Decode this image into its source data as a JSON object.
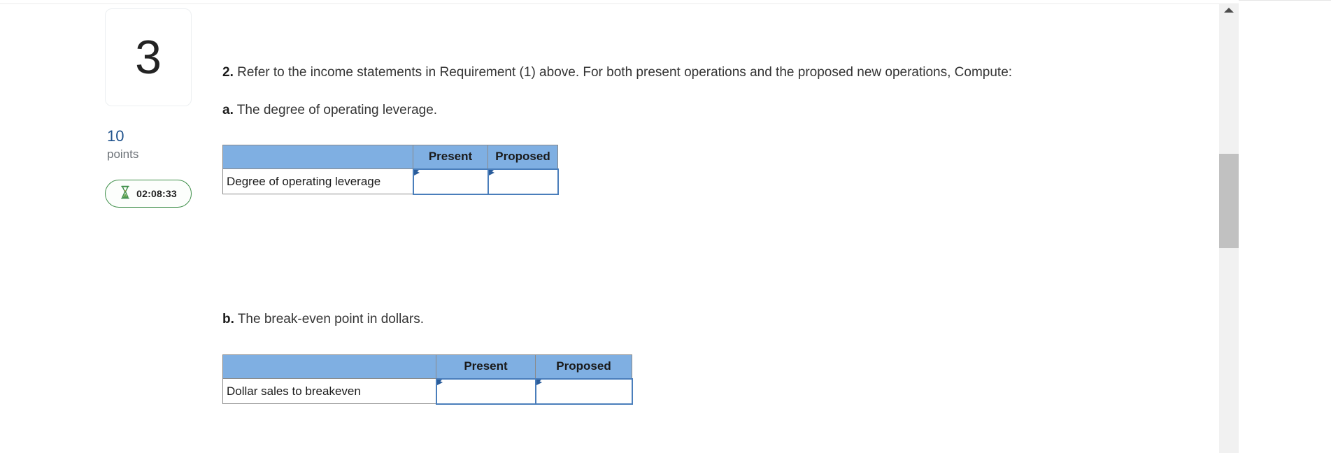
{
  "question": {
    "number": "3",
    "points_value": "10",
    "points_label": "points",
    "timer": "02:08:33",
    "timer_icon": "hourglass-icon"
  },
  "prompt": {
    "main_lead": "2.",
    "main_text": "Refer to the income statements in Requirement (1) above. For both present operations and the proposed new operations, Compute:",
    "sub_a_lead": "a.",
    "sub_a_text": "The degree of operating leverage.",
    "sub_b_lead": "b.",
    "sub_b_text": "The break-even point in dollars."
  },
  "tables": {
    "a": {
      "headers": [
        "",
        "Present",
        "Proposed"
      ],
      "row_label": "Degree of operating leverage",
      "cells": [
        "",
        ""
      ]
    },
    "b": {
      "headers": [
        "",
        "Present",
        "Proposed"
      ],
      "row_label": "Dollar sales to breakeven",
      "cells": [
        "",
        ""
      ]
    }
  },
  "scrollbar": {
    "up_arrow_icon": "chevron-up-icon"
  },
  "colors": {
    "header_blue": "#7FAFE2",
    "entry_border_blue": "#4a7ebb",
    "points_blue": "#20538d",
    "timer_green": "#3f8f4a"
  }
}
